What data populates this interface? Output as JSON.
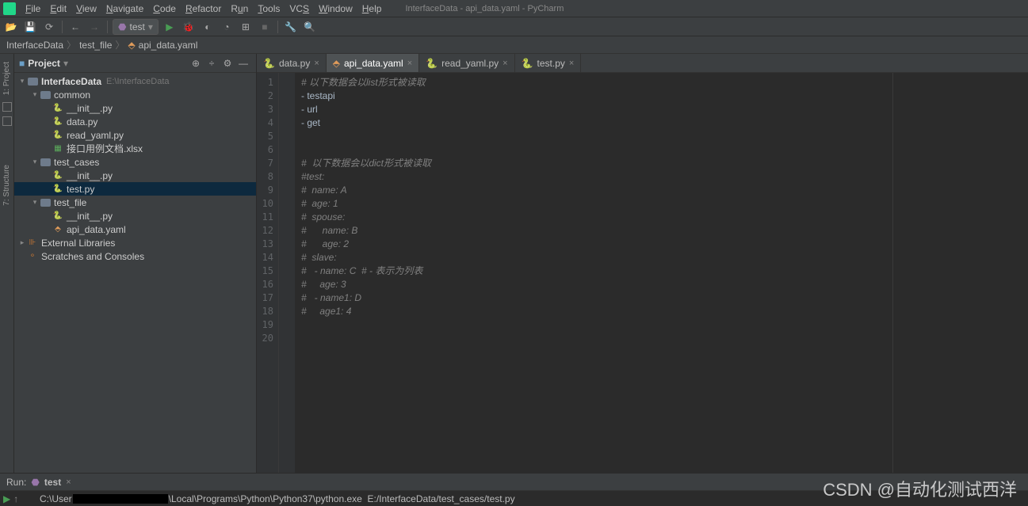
{
  "window": {
    "title": "InterfaceData - api_data.yaml - PyCharm"
  },
  "menu": [
    "File",
    "Edit",
    "View",
    "Navigate",
    "Code",
    "Refactor",
    "Run",
    "Tools",
    "VCS",
    "Window",
    "Help"
  ],
  "run_config": {
    "name": "test"
  },
  "breadcrumb": [
    "InterfaceData",
    "test_file",
    "api_data.yaml"
  ],
  "side_tabs": [
    "1: Project",
    "7: Structure"
  ],
  "panel": {
    "title": "Project"
  },
  "tree": {
    "root": {
      "name": "InterfaceData",
      "hint": "E:\\InterfaceData"
    },
    "common": {
      "name": "common",
      "children": [
        "__init__.py",
        "data.py",
        "read_yaml.py",
        "接口用例文档.xlsx"
      ]
    },
    "test_cases": {
      "name": "test_cases",
      "children": [
        "__init__.py",
        "test.py"
      ]
    },
    "test_file": {
      "name": "test_file",
      "children": [
        "__init__.py",
        "api_data.yaml"
      ]
    },
    "ext": {
      "name": "External Libraries"
    },
    "scratch": {
      "name": "Scratches and Consoles"
    }
  },
  "tabs": [
    {
      "label": "data.py",
      "type": "py"
    },
    {
      "label": "api_data.yaml",
      "type": "yaml",
      "active": true
    },
    {
      "label": "read_yaml.py",
      "type": "py"
    },
    {
      "label": "test.py",
      "type": "py"
    }
  ],
  "code": {
    "lines": [
      "# 以下数据会以list形式被读取",
      "- testapi",
      "- url",
      "- get",
      "",
      "",
      "#  以下数据会以dict形式被读取",
      "#test:",
      "#  name: A",
      "#  age: 1",
      "#  spouse:",
      "#      name: B",
      "#      age: 2",
      "#  slave:",
      "#   - name: C  # - 表示为列表",
      "#     age: 3",
      "#   - name1: D",
      "#     age1: 4",
      "",
      ""
    ]
  },
  "run_panel": {
    "label": "Run:",
    "config": "test",
    "output": "C:\\User                \\Local\\Programs\\Python\\Python37\\python.exe  E:/InterfaceData/test_cases/test.py"
  },
  "watermark": "CSDN @自动化测试西洋"
}
